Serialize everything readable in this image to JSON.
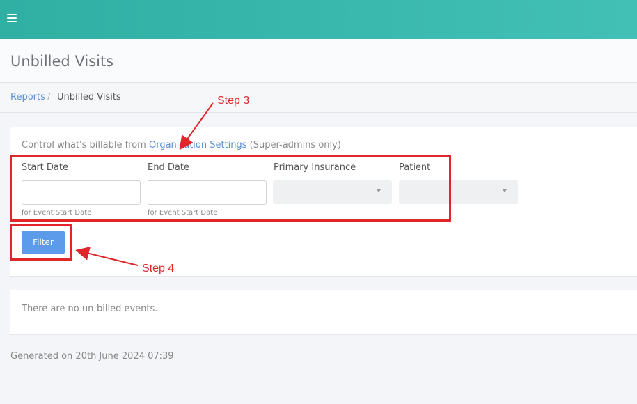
{
  "topbar": {
    "menu_icon": "hamburger-icon",
    "color_start": "#2fb0a3",
    "color_end": "#42c0b6"
  },
  "header": {
    "title": "Unbilled Visits"
  },
  "breadcrumb": {
    "parent": "Reports",
    "separator": "/",
    "current": "Unbilled Visits"
  },
  "filters": {
    "note_prefix": "Control what's billable from ",
    "note_link": "Organization Settings",
    "note_suffix": " (Super-admins only)",
    "start_date": {
      "label": "Start Date",
      "value": "",
      "help": "for Event Start Date"
    },
    "end_date": {
      "label": "End Date",
      "value": "",
      "help": "for Event Start Date"
    },
    "primary_insurance": {
      "label": "Primary Insurance",
      "selected": "---"
    },
    "patient": {
      "label": "Patient",
      "selected": "---------"
    },
    "filter_button": "Filter"
  },
  "results": {
    "empty_message": "There are no un-billed events."
  },
  "footer": {
    "generated": "Generated on 20th June 2024 07:39"
  },
  "annotations": {
    "step3": "Step 3",
    "step4": "Step 4",
    "color": "#e0262a"
  }
}
